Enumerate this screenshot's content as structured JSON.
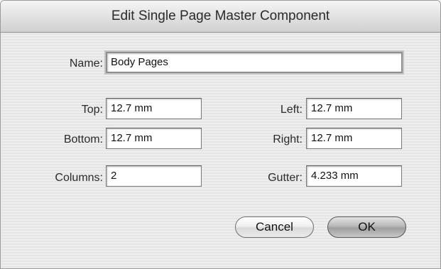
{
  "dialog": {
    "title": "Edit Single Page Master Component"
  },
  "fields": {
    "name": {
      "label": "Name:",
      "value": "Body Pages"
    },
    "top": {
      "label": "Top:",
      "value": "12.7 mm"
    },
    "bottom": {
      "label": "Bottom:",
      "value": "12.7 mm"
    },
    "columns": {
      "label": "Columns:",
      "value": "2"
    },
    "left": {
      "label": "Left:",
      "value": "12.7 mm"
    },
    "right": {
      "label": "Right:",
      "value": "12.7 mm"
    },
    "gutter": {
      "label": "Gutter:",
      "value": "4.233 mm"
    }
  },
  "buttons": {
    "cancel": "Cancel",
    "ok": "OK"
  }
}
